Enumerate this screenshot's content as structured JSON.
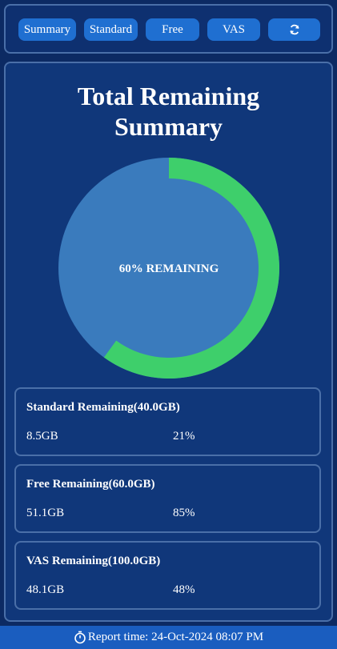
{
  "tabs": [
    {
      "label": "Summary"
    },
    {
      "label": "Standard"
    },
    {
      "label": "Free"
    },
    {
      "label": "VAS"
    },
    {
      "label": "",
      "icon": "refresh-icon"
    }
  ],
  "summary": {
    "title_line1": "Total Remaining",
    "title_line2": "Summary",
    "remaining_fraction": 0.6,
    "center_label": "60% REMAINING",
    "colors": {
      "remaining": "#3ecf6b",
      "used": "#3a7bbd"
    }
  },
  "cards": [
    {
      "title": "Standard Remaining(40.0GB)",
      "amount": "8.5GB",
      "percent": "21%"
    },
    {
      "title": "Free Remaining(60.0GB)",
      "amount": "51.1GB",
      "percent": "85%"
    },
    {
      "title": "VAS Remaining(100.0GB)",
      "amount": "48.1GB",
      "percent": "48%"
    }
  ],
  "footer": {
    "text": "Report time: 24-Oct-2024 08:07 PM",
    "icon": "stopwatch-icon"
  }
}
